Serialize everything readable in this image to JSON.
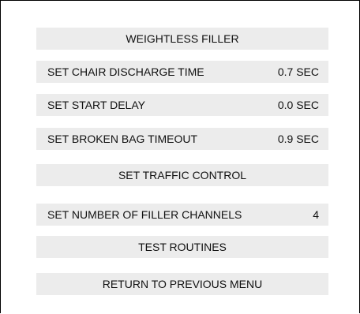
{
  "menu": {
    "title_button": "WEIGHTLESS FILLER",
    "chair_discharge": {
      "label": "SET CHAIR DISCHARGE TIME",
      "value": "0.7 SEC"
    },
    "start_delay": {
      "label": "SET START DELAY",
      "value": "0.0 SEC"
    },
    "broken_bag": {
      "label": "SET BROKEN BAG TIMEOUT",
      "value": "0.9 SEC"
    },
    "traffic_control": "SET TRAFFIC CONTROL",
    "filler_channels": {
      "label": "SET NUMBER OF FILLER CHANNELS",
      "value": "4"
    },
    "test_routines": "TEST ROUTINES",
    "return": "RETURN TO PREVIOUS MENU"
  },
  "colors": {
    "button_bg": "#ececec",
    "text": "#111111",
    "border": "#000000"
  }
}
